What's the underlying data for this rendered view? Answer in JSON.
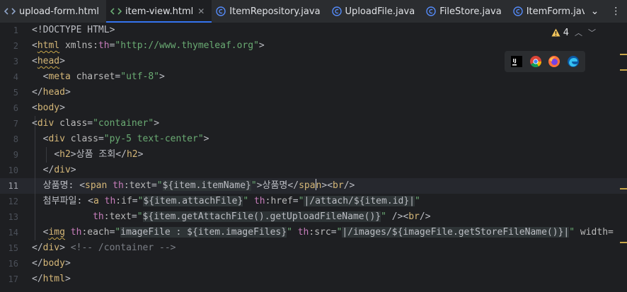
{
  "tabs": [
    {
      "label": "upload-form.html",
      "icon": "html-file-icon",
      "active": false
    },
    {
      "label": "item-view.html",
      "icon": "html-file-icon",
      "active": true,
      "closable": true
    },
    {
      "label": "ItemRepository.java",
      "icon": "java-class-icon",
      "active": false
    },
    {
      "label": "UploadFile.java",
      "icon": "java-class-icon",
      "active": false
    },
    {
      "label": "FileStore.java",
      "icon": "java-class-icon",
      "active": false
    },
    {
      "label": "ItemForm.java",
      "icon": "java-class-icon",
      "active": false
    },
    {
      "label": "",
      "icon": "java-class-icon",
      "active": false
    }
  ],
  "tab_actions": {
    "more_icon": "more-vertical-icon"
  },
  "inspections": {
    "warning_count": "4",
    "icon": "warning-icon"
  },
  "browsers": [
    "intellij-icon",
    "chrome-icon",
    "firefox-icon",
    "edge-icon"
  ],
  "editor": {
    "current_line": 11,
    "line_numbers": [
      "1",
      "2",
      "3",
      "4",
      "5",
      "6",
      "7",
      "8",
      "9",
      "10",
      "11",
      "12",
      "13",
      "14",
      "15",
      "16",
      "17"
    ],
    "code": {
      "l1": "<!DOCTYPE HTML>",
      "l2a": "<",
      "l2t": "html",
      "l2b": " xmlns:",
      "l2n": "th",
      "l2c": "=",
      "l2v": "\"http://www.thymeleaf.org\"",
      "l2d": ">",
      "l3t": "head",
      "l4t": "meta",
      "l4a": "charset",
      "l4v": "\"utf-8\"",
      "l5t": "head",
      "l6t": "body",
      "l7t": "div",
      "l7a": "class",
      "l7v": "\"container\"",
      "l8t": "div",
      "l8a": "class",
      "l8v": "\"py-5 text-center\"",
      "l9t": "h2",
      "l9txt": "상품 조회",
      "l10t": "div",
      "l11txt": "상품명: ",
      "l11t": "span",
      "l11n": "th",
      "l11a": ":text",
      "l11q": "\"",
      "l11e": "${item.itemName}",
      "l11txt2": "상품명",
      "l11t2a": "spa",
      "l11t2b": "n",
      "l11br": "br",
      "l12txt": "첨부파일: ",
      "l12t": "a",
      "l12n": "th",
      "l12a": ":if",
      "l12q": "\"",
      "l12e": "${item.attachFile}",
      "l12n2": "th",
      "l12a2": ":href",
      "l12e2": "|/attach/${item.id}|",
      "l13n": "th",
      "l13a": ":text",
      "l13e": "${item.getAttachFile().getUploadFileName()}",
      "l13br": "br",
      "l14t": "img",
      "l14n": "th",
      "l14a": ":each",
      "l14e": "imageFile : ${item.imageFiles}",
      "l14n2": "th",
      "l14a2": ":src",
      "l14e2": "|/images/${imageFile.getStoreFileName()}|",
      "l14a3": " width=",
      "l15t": "div",
      "l15c": "<!-- /container -->",
      "l16t": "body",
      "l17t": "html"
    }
  }
}
